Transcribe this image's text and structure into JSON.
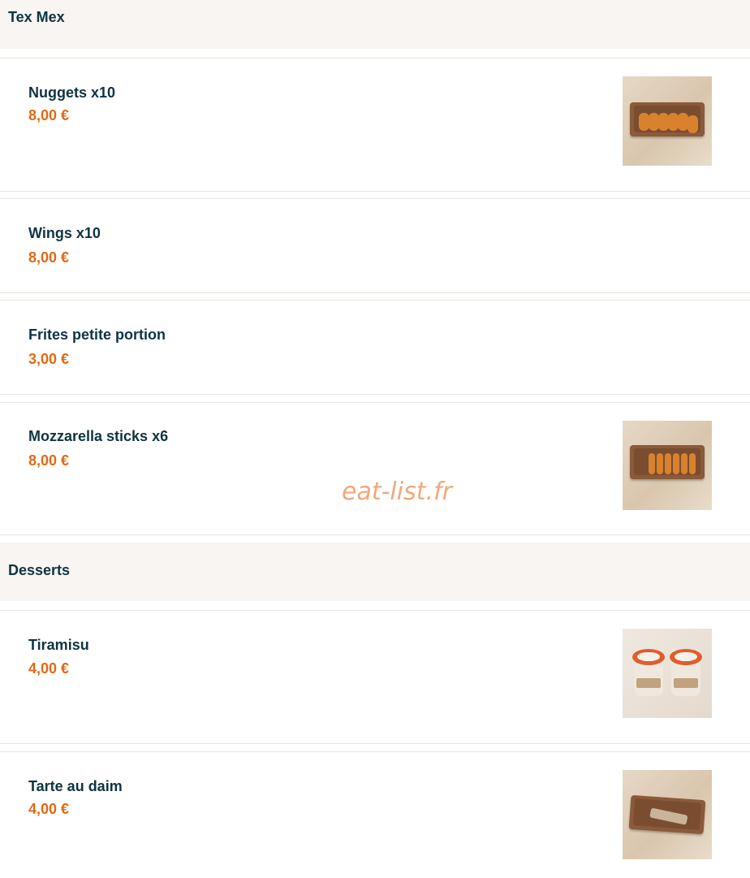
{
  "sections": [
    {
      "title": "Tex Mex",
      "items": [
        {
          "name": "Nuggets x10",
          "price": "8,00 €",
          "image": "nuggets-photo"
        },
        {
          "name": "Wings x10",
          "price": "8,00 €"
        },
        {
          "name": "Frites petite portion",
          "price": "3,00 €"
        },
        {
          "name": "Mozzarella sticks x6",
          "price": "8,00 €",
          "image": "mozzarella-sticks-photo"
        }
      ]
    },
    {
      "title": "Desserts",
      "items": [
        {
          "name": "Tiramisu",
          "price": "4,00 €",
          "image": "tiramisu-photo"
        },
        {
          "name": "Tarte au daim",
          "price": "4,00 €",
          "image": "tarte-au-daim-photo"
        }
      ]
    }
  ],
  "watermark": "eat-list.fr"
}
